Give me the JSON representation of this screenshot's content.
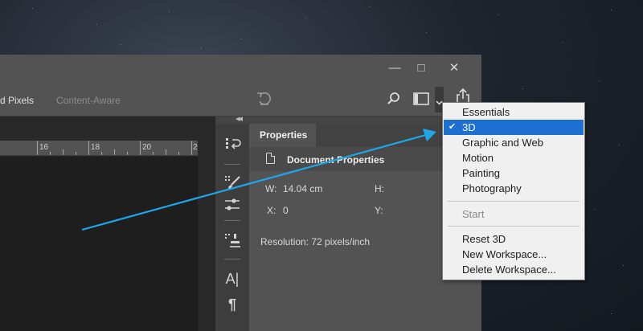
{
  "options_bar": {
    "text_a": "d Pixels",
    "text_b": "Content-Aware"
  },
  "window_controls": {
    "minimize": "—",
    "restore": "□",
    "close": "✕"
  },
  "ruler": {
    "labels": [
      "16",
      "18",
      "20",
      "2"
    ]
  },
  "panel_collapse": "◂◂",
  "properties_panel": {
    "tab_label": "Properties",
    "section_title": "Document Properties",
    "width_label": "W:",
    "width_value": "14.04 cm",
    "height_label": "H:",
    "x_label": "X:",
    "x_value": "0",
    "y_label": "Y:",
    "resolution": "Resolution: 72 pixels/inch"
  },
  "workspace_menu": {
    "items": [
      {
        "label": "Essentials",
        "state": "normal"
      },
      {
        "label": "3D",
        "state": "selected",
        "checked": true
      },
      {
        "label": "Graphic and Web",
        "state": "normal"
      },
      {
        "label": "Motion",
        "state": "normal"
      },
      {
        "label": "Painting",
        "state": "normal"
      },
      {
        "label": "Photography",
        "state": "normal"
      },
      {
        "label": "Start",
        "state": "disabled"
      },
      {
        "label": "Reset 3D",
        "state": "normal"
      },
      {
        "label": "New Workspace...",
        "state": "normal"
      },
      {
        "label": "Delete Workspace...",
        "state": "normal"
      }
    ],
    "check_glyph": "✔"
  },
  "tool_glyphs": {
    "character": "A|",
    "paragraph": "¶"
  },
  "colors": {
    "menu_highlight": "#1e6fd2",
    "annotation_arrow": "#1ea7e8",
    "panel_bg": "#535353",
    "dark_bg": "#282828"
  },
  "icons": [
    "minimize-icon",
    "restore-icon",
    "close-icon",
    "undo-rotate-icon",
    "search-icon",
    "workspace-layout-icon",
    "chevron-down-icon",
    "share-icon",
    "history-icon",
    "brush-settings-icon",
    "adjustments-icon",
    "clone-source-icon",
    "character-icon",
    "paragraph-icon",
    "document-icon"
  ]
}
